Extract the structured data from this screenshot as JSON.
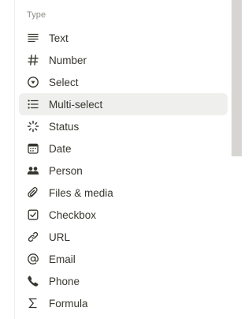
{
  "menu": {
    "section_label": "Type",
    "items": [
      {
        "label": "Text",
        "icon": "text-lines-icon"
      },
      {
        "label": "Number",
        "icon": "hash-icon"
      },
      {
        "label": "Select",
        "icon": "select-circle-icon"
      },
      {
        "label": "Multi-select",
        "icon": "bullet-list-icon",
        "hovered": true
      },
      {
        "label": "Status",
        "icon": "status-spinner-icon"
      },
      {
        "label": "Date",
        "icon": "calendar-icon"
      },
      {
        "label": "Person",
        "icon": "people-icon"
      },
      {
        "label": "Files & media",
        "icon": "paperclip-icon"
      },
      {
        "label": "Checkbox",
        "icon": "checkbox-icon"
      },
      {
        "label": "URL",
        "icon": "link-icon"
      },
      {
        "label": "Email",
        "icon": "at-sign-icon"
      },
      {
        "label": "Phone",
        "icon": "phone-icon"
      },
      {
        "label": "Formula",
        "icon": "sigma-icon"
      }
    ]
  }
}
